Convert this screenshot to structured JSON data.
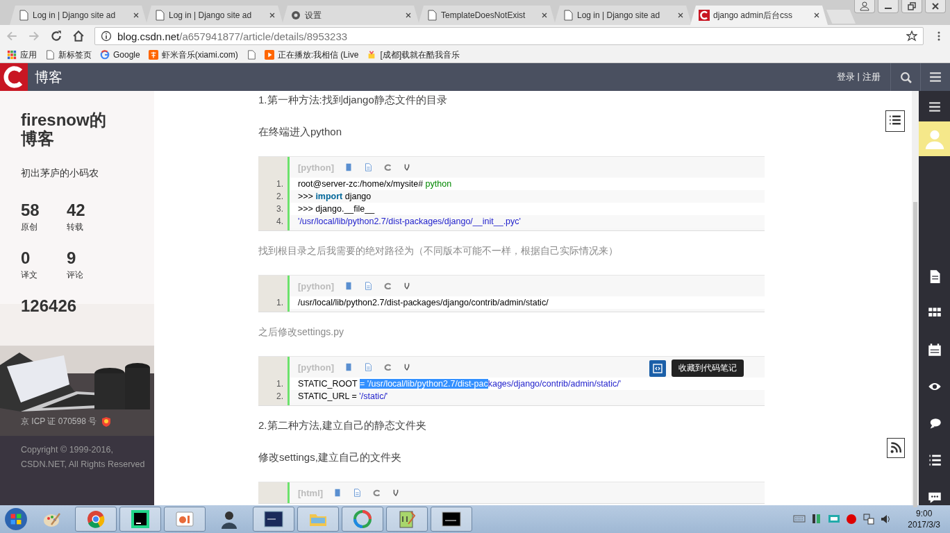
{
  "browser": {
    "tabs": [
      {
        "title": "Log in | Django site ad",
        "kind": "page",
        "selected": false
      },
      {
        "title": "Log in | Django site ad",
        "kind": "page",
        "selected": false
      },
      {
        "title": "设置",
        "kind": "gear",
        "selected": false
      },
      {
        "title": "TemplateDoesNotExist",
        "kind": "page",
        "selected": false
      },
      {
        "title": "Log in | Django site ad",
        "kind": "page",
        "selected": false
      },
      {
        "title": "django admin后台css",
        "kind": "csdn",
        "selected": true
      }
    ],
    "url_host": "blog.csdn.net",
    "url_path": "/a657941877/article/details/8953233",
    "bookmarks": [
      {
        "label": "应用",
        "kind": "apps"
      },
      {
        "label": "新标签页",
        "kind": "page"
      },
      {
        "label": "Google",
        "kind": "google"
      },
      {
        "label": "虾米音乐(xiami.com)",
        "kind": "xiami"
      },
      {
        "kind": "page"
      },
      {
        "label": "正在播放:我相信 (Live",
        "kind": "play"
      },
      {
        "label": "[成都]载就在酷我音乐",
        "kind": "game"
      }
    ]
  },
  "site_header": {
    "title": "博客",
    "login": "登录",
    "separator": "|",
    "register": "注册"
  },
  "sidebar": {
    "blog_title": "firesnow的博客",
    "motto": "初出茅庐的小码农",
    "stats": [
      {
        "value": "58",
        "label": "原创"
      },
      {
        "value": "42",
        "label": "转载"
      },
      {
        "value": "0",
        "label": "译文"
      },
      {
        "value": "9",
        "label": "评论"
      },
      {
        "value": "126426"
      }
    ],
    "icp": "京 ICP 证 070598 号",
    "copyright": "Copyright © 1999-2016, CSDN.NET, All Rights Reserved"
  },
  "article": [
    {
      "kind": "paragraph",
      "text": "1.第一种方法:找到django静态文件的目录",
      "muted": false
    },
    {
      "kind": "paragraph",
      "text": "在终端进入python",
      "muted": false
    },
    {
      "kind": "code",
      "lang": "[python]",
      "lines": [
        {
          "number": "1.",
          "tokens": [
            {
              "text": "root@server-zc:/home/x/mysite# ",
              "kind": "plain"
            },
            {
              "text": "python",
              "kind": "comment"
            }
          ]
        },
        {
          "number": "2.",
          "tokens": [
            {
              "text": ">>> ",
              "kind": "plain"
            },
            {
              "text": "import",
              "kind": "keyword"
            },
            {
              "text": " django",
              "kind": "plain"
            }
          ]
        },
        {
          "number": "3.",
          "tokens": [
            {
              "text": ">>> django.__file__",
              "kind": "plain"
            }
          ]
        },
        {
          "number": "4.",
          "tokens": [
            {
              "text": "'/usr/local/lib/python2.7/dist-packages/django/__init__.pyc'",
              "kind": "string"
            }
          ]
        }
      ]
    },
    {
      "kind": "paragraph",
      "text": "找到根目录之后我需要的绝对路径为（不同版本可能不一样，根据自己实际情况来）",
      "muted": true
    },
    {
      "kind": "code",
      "lang": "[python]",
      "lines": [
        {
          "number": "1.",
          "tokens": [
            {
              "text": "/usr/local/lib/python2.7/dist-packages/django/contrib/admin/static/",
              "kind": "plain"
            }
          ]
        }
      ]
    },
    {
      "kind": "paragraph",
      "text": "之后修改settings.py",
      "muted": true
    },
    {
      "kind": "code",
      "lang": "[python]",
      "tooltip": "收藏到代码笔记",
      "lines": [
        {
          "number": "1.",
          "tokens": [
            {
              "text": "STATIC_ROOT ",
              "kind": "plain"
            },
            {
              "text": "= '/usr/local/lib/python2.7/dist-pac",
              "kind": "selected"
            },
            {
              "text": "kages/django/contrib/admin/static/'",
              "kind": "string"
            }
          ]
        },
        {
          "number": "2.",
          "tokens": [
            {
              "text": "STATIC_URL = ",
              "kind": "plain"
            },
            {
              "text": "'/static/'",
              "kind": "string"
            }
          ]
        }
      ]
    },
    {
      "kind": "paragraph",
      "text": "2.第二种方法,建立自己的静态文件夹",
      "muted": false
    },
    {
      "kind": "paragraph",
      "text": "修改settings,建立自己的文件夹",
      "muted": false
    },
    {
      "kind": "code",
      "lang": "[html]"
    }
  ],
  "taskbar": {
    "apps": [
      {
        "kind": "paint",
        "active": false
      },
      {
        "kind": "chrome",
        "active": true
      },
      {
        "kind": "pycharm",
        "active": true
      },
      {
        "kind": "slides",
        "active": true
      },
      {
        "kind": "person",
        "active": false
      },
      {
        "kind": "terminal",
        "active": true
      },
      {
        "kind": "folder",
        "active": true
      },
      {
        "kind": "ring",
        "active": true
      },
      {
        "kind": "notepad",
        "active": true
      },
      {
        "kind": "cmd",
        "active": true
      }
    ],
    "time": "9:00",
    "date": "2017/3/3"
  }
}
